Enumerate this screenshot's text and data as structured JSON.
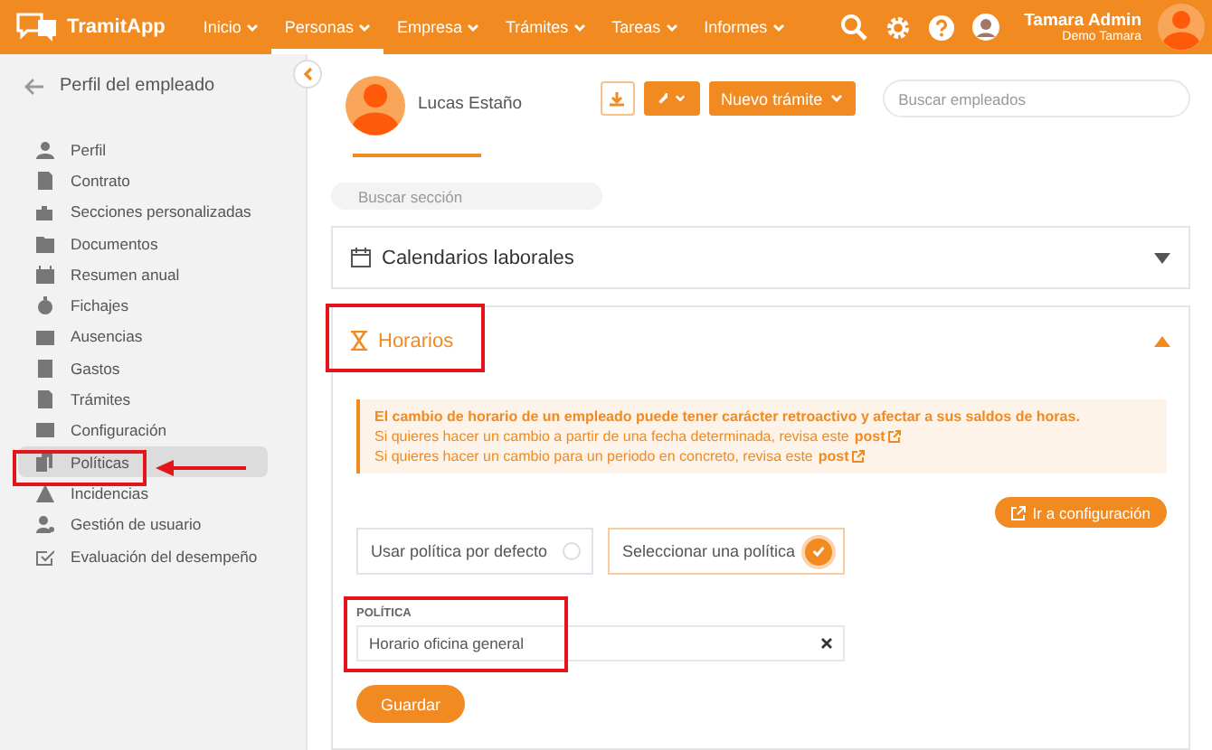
{
  "header": {
    "logo": "TramitApp",
    "nav": [
      {
        "label": "Inicio",
        "selected": false
      },
      {
        "label": "Personas",
        "selected": true
      },
      {
        "label": "Empresa",
        "selected": false
      },
      {
        "label": "Trámites",
        "selected": false
      },
      {
        "label": "Tareas",
        "selected": false
      },
      {
        "label": "Informes",
        "selected": false
      }
    ],
    "user_name": "Tamara Admin",
    "company": "Demo Tamara"
  },
  "sidebar": {
    "title": "Perfil del empleado",
    "items": [
      {
        "label": "Perfil",
        "selected": false
      },
      {
        "label": "Contrato",
        "selected": false
      },
      {
        "label": "Secciones personalizadas",
        "selected": false
      },
      {
        "label": "Documentos",
        "selected": false
      },
      {
        "label": "Resumen anual",
        "selected": false
      },
      {
        "label": "Fichajes",
        "selected": false
      },
      {
        "label": "Ausencias",
        "selected": false
      },
      {
        "label": "Gastos",
        "selected": false
      },
      {
        "label": "Trámites",
        "selected": false
      },
      {
        "label": "Configuración",
        "selected": false
      },
      {
        "label": "Políticas",
        "selected": true
      },
      {
        "label": "Incidencias",
        "selected": false
      },
      {
        "label": "Gestión de usuario",
        "selected": false
      },
      {
        "label": "Evaluación del desempeño",
        "selected": false
      }
    ]
  },
  "profile": {
    "name": "Lucas Estaño",
    "new_procedure_button": "Nuevo trámite",
    "employee_search": {
      "placeholder": "Buscar empleados"
    }
  },
  "section_search": {
    "placeholder": "Buscar sección"
  },
  "sections": [
    {
      "title": "Calendarios laborales",
      "expanded": false
    },
    {
      "title": "Horarios",
      "expanded": true
    }
  ],
  "schedule": {
    "alert": {
      "warning": "El cambio de horario de un empleado puede tener carácter retroactivo y afectar a sus saldos de horas.",
      "lines": [
        {
          "text": "Si quieres hacer un cambio a partir de una fecha determinada, revisa este",
          "link": "post"
        },
        {
          "text": "Si quieres hacer un cambio para un periodo en concreto, revisa este",
          "link": "post"
        }
      ]
    },
    "config_button": "Ir a configuración",
    "options": [
      {
        "label": "Usar política por defecto",
        "selected": false
      },
      {
        "label": "Seleccionar una política",
        "selected": true
      }
    ],
    "field": {
      "label": "POLÍTICA",
      "value": "Horario oficina general"
    },
    "save_button": "Guardar"
  }
}
